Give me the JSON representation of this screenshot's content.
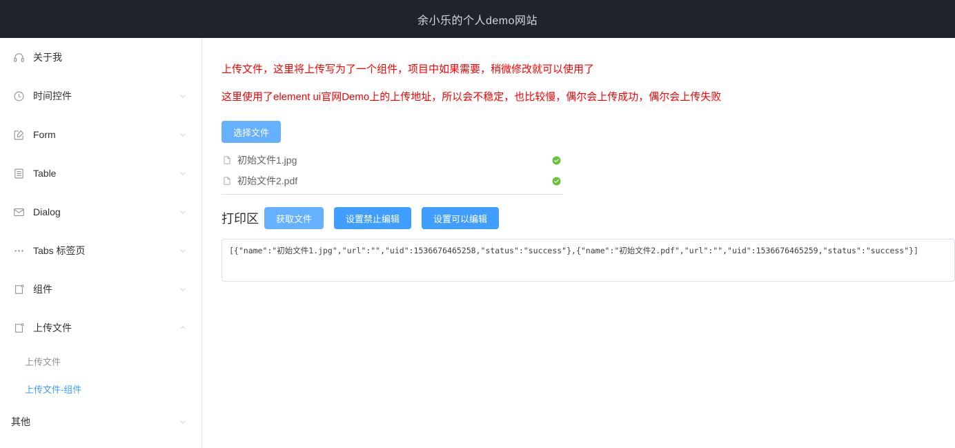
{
  "header": {
    "title": "余小乐的个人demo网站"
  },
  "sidebar": {
    "items": [
      {
        "label": "关于我",
        "icon": "headphones-icon",
        "arrow": "none"
      },
      {
        "label": "时间控件",
        "icon": "clock-icon",
        "arrow": "down"
      },
      {
        "label": "Form",
        "icon": "edit-square-icon",
        "arrow": "down"
      },
      {
        "label": "Table",
        "icon": "list-document-icon",
        "arrow": "down"
      },
      {
        "label": "Dialog",
        "icon": "envelope-icon",
        "arrow": "down"
      },
      {
        "label": "Tabs 标签页",
        "icon": "ellipsis-icon",
        "arrow": "down"
      },
      {
        "label": "组件",
        "icon": "component-bracket-icon",
        "arrow": "down"
      },
      {
        "label": "上传文件",
        "icon": "component-bracket-icon",
        "arrow": "up"
      }
    ],
    "upload_children": [
      {
        "label": "上传文件",
        "active": false
      },
      {
        "label": "上传文件-组件",
        "active": true
      }
    ],
    "other": {
      "label": "其他",
      "arrow": "down"
    }
  },
  "main": {
    "notes": [
      "上传文件，这里将上传写为了一个组件，项目中如果需要，稍微修改就可以使用了",
      "这里使用了element ui官网Demo上的上传地址，所以会不稳定，也比较慢，偶尔会上传成功，偶尔会上传失败"
    ],
    "select_file_button": "选择文件",
    "files": [
      {
        "name": "初始文件1.jpg",
        "status": "success",
        "icon": "document-icon",
        "status_icon": "circle-check-icon"
      },
      {
        "name": "初始文件2.pdf",
        "status": "success",
        "icon": "document-icon",
        "status_icon": "circle-check-icon"
      }
    ],
    "print_area": {
      "label": "打印区",
      "buttons": [
        {
          "label": "获取文件",
          "state": "hover"
        },
        {
          "label": "设置禁止编辑",
          "state": "normal"
        },
        {
          "label": "设置可以编辑",
          "state": "normal"
        }
      ]
    },
    "json_output": "[{\"name\":\"初始文件1.jpg\",\"url\":\"\",\"uid\":1536676465258,\"status\":\"success\"},{\"name\":\"初始文件2.pdf\",\"url\":\"\",\"uid\":1536676465259,\"status\":\"success\"}]"
  },
  "colors": {
    "header_bg": "#20232a",
    "primary": "#409eff",
    "primary_light": "#66b1ff",
    "note_red": "#ff0000",
    "success_green": "#67c23a",
    "active_blue": "#409eff"
  }
}
